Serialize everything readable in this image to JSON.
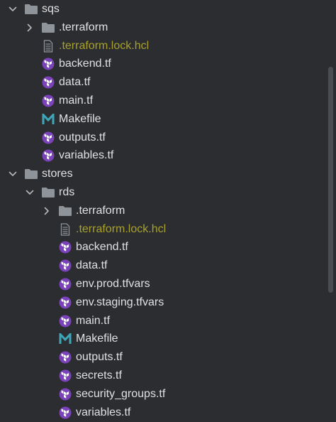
{
  "colors": {
    "background": "#2b2d30",
    "text": "#dfe1e5",
    "ignored_text": "#a9a12c",
    "folder_icon": "#8f949b",
    "terraform_icon": "#7b42bc",
    "makefile_icon": "#3ea6b8",
    "chevron": "#b5b8bd"
  },
  "tree": [
    {
      "label": "sqs",
      "type": "folder",
      "expanded": true,
      "depth": 0,
      "icon": "folder-icon"
    },
    {
      "label": ".terraform",
      "type": "folder",
      "expanded": false,
      "depth": 1,
      "icon": "folder-icon"
    },
    {
      "label": ".terraform.lock.hcl",
      "type": "file",
      "ignored": true,
      "depth": 1,
      "icon": "text-file-icon"
    },
    {
      "label": "backend.tf",
      "type": "file",
      "depth": 1,
      "icon": "terraform-icon"
    },
    {
      "label": "data.tf",
      "type": "file",
      "depth": 1,
      "icon": "terraform-icon"
    },
    {
      "label": "main.tf",
      "type": "file",
      "depth": 1,
      "icon": "terraform-icon"
    },
    {
      "label": "Makefile",
      "type": "file",
      "depth": 1,
      "icon": "makefile-icon"
    },
    {
      "label": "outputs.tf",
      "type": "file",
      "depth": 1,
      "icon": "terraform-icon"
    },
    {
      "label": "variables.tf",
      "type": "file",
      "depth": 1,
      "icon": "terraform-icon"
    },
    {
      "label": "stores",
      "type": "folder",
      "expanded": true,
      "depth": 0,
      "icon": "folder-icon"
    },
    {
      "label": "rds",
      "type": "folder",
      "expanded": true,
      "depth": 1,
      "icon": "folder-icon"
    },
    {
      "label": ".terraform",
      "type": "folder",
      "expanded": false,
      "depth": 2,
      "icon": "folder-icon"
    },
    {
      "label": ".terraform.lock.hcl",
      "type": "file",
      "ignored": true,
      "depth": 2,
      "icon": "text-file-icon"
    },
    {
      "label": "backend.tf",
      "type": "file",
      "depth": 2,
      "icon": "terraform-icon"
    },
    {
      "label": "data.tf",
      "type": "file",
      "depth": 2,
      "icon": "terraform-icon"
    },
    {
      "label": "env.prod.tfvars",
      "type": "file",
      "depth": 2,
      "icon": "terraform-icon"
    },
    {
      "label": "env.staging.tfvars",
      "type": "file",
      "depth": 2,
      "icon": "terraform-icon"
    },
    {
      "label": "main.tf",
      "type": "file",
      "depth": 2,
      "icon": "terraform-icon"
    },
    {
      "label": "Makefile",
      "type": "file",
      "depth": 2,
      "icon": "makefile-icon"
    },
    {
      "label": "outputs.tf",
      "type": "file",
      "depth": 2,
      "icon": "terraform-icon"
    },
    {
      "label": "secrets.tf",
      "type": "file",
      "depth": 2,
      "icon": "terraform-icon"
    },
    {
      "label": "security_groups.tf",
      "type": "file",
      "depth": 2,
      "icon": "terraform-icon"
    },
    {
      "label": "variables.tf",
      "type": "file",
      "depth": 2,
      "icon": "terraform-icon"
    }
  ]
}
